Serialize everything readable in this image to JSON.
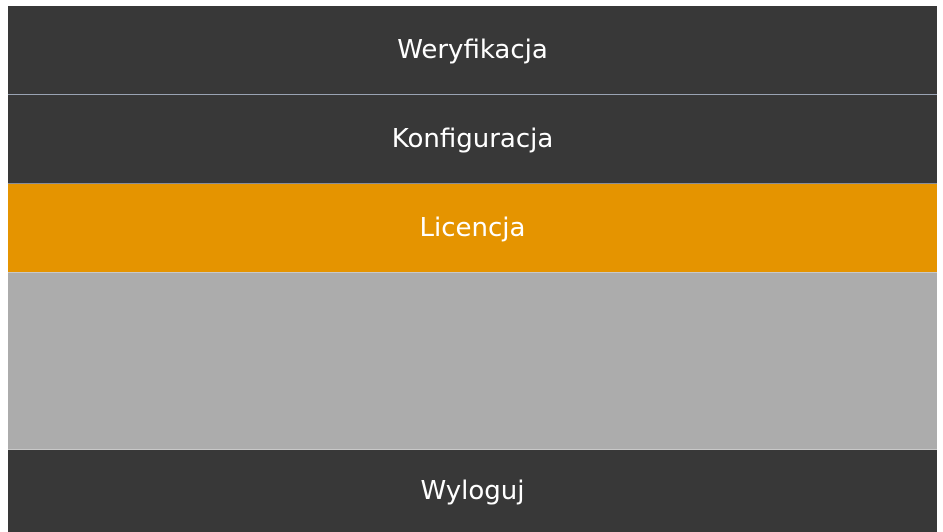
{
  "menu": {
    "items": [
      {
        "label": "Weryfikacja",
        "state": "normal"
      },
      {
        "label": "Konfiguracja",
        "state": "normal"
      },
      {
        "label": "Licencja",
        "state": "active"
      },
      {
        "label": "Wyloguj",
        "state": "normal"
      }
    ]
  },
  "colors": {
    "item_background": "#383838",
    "active_background": "#e59400",
    "empty_area": "#acacac",
    "text": "#ffffff"
  }
}
